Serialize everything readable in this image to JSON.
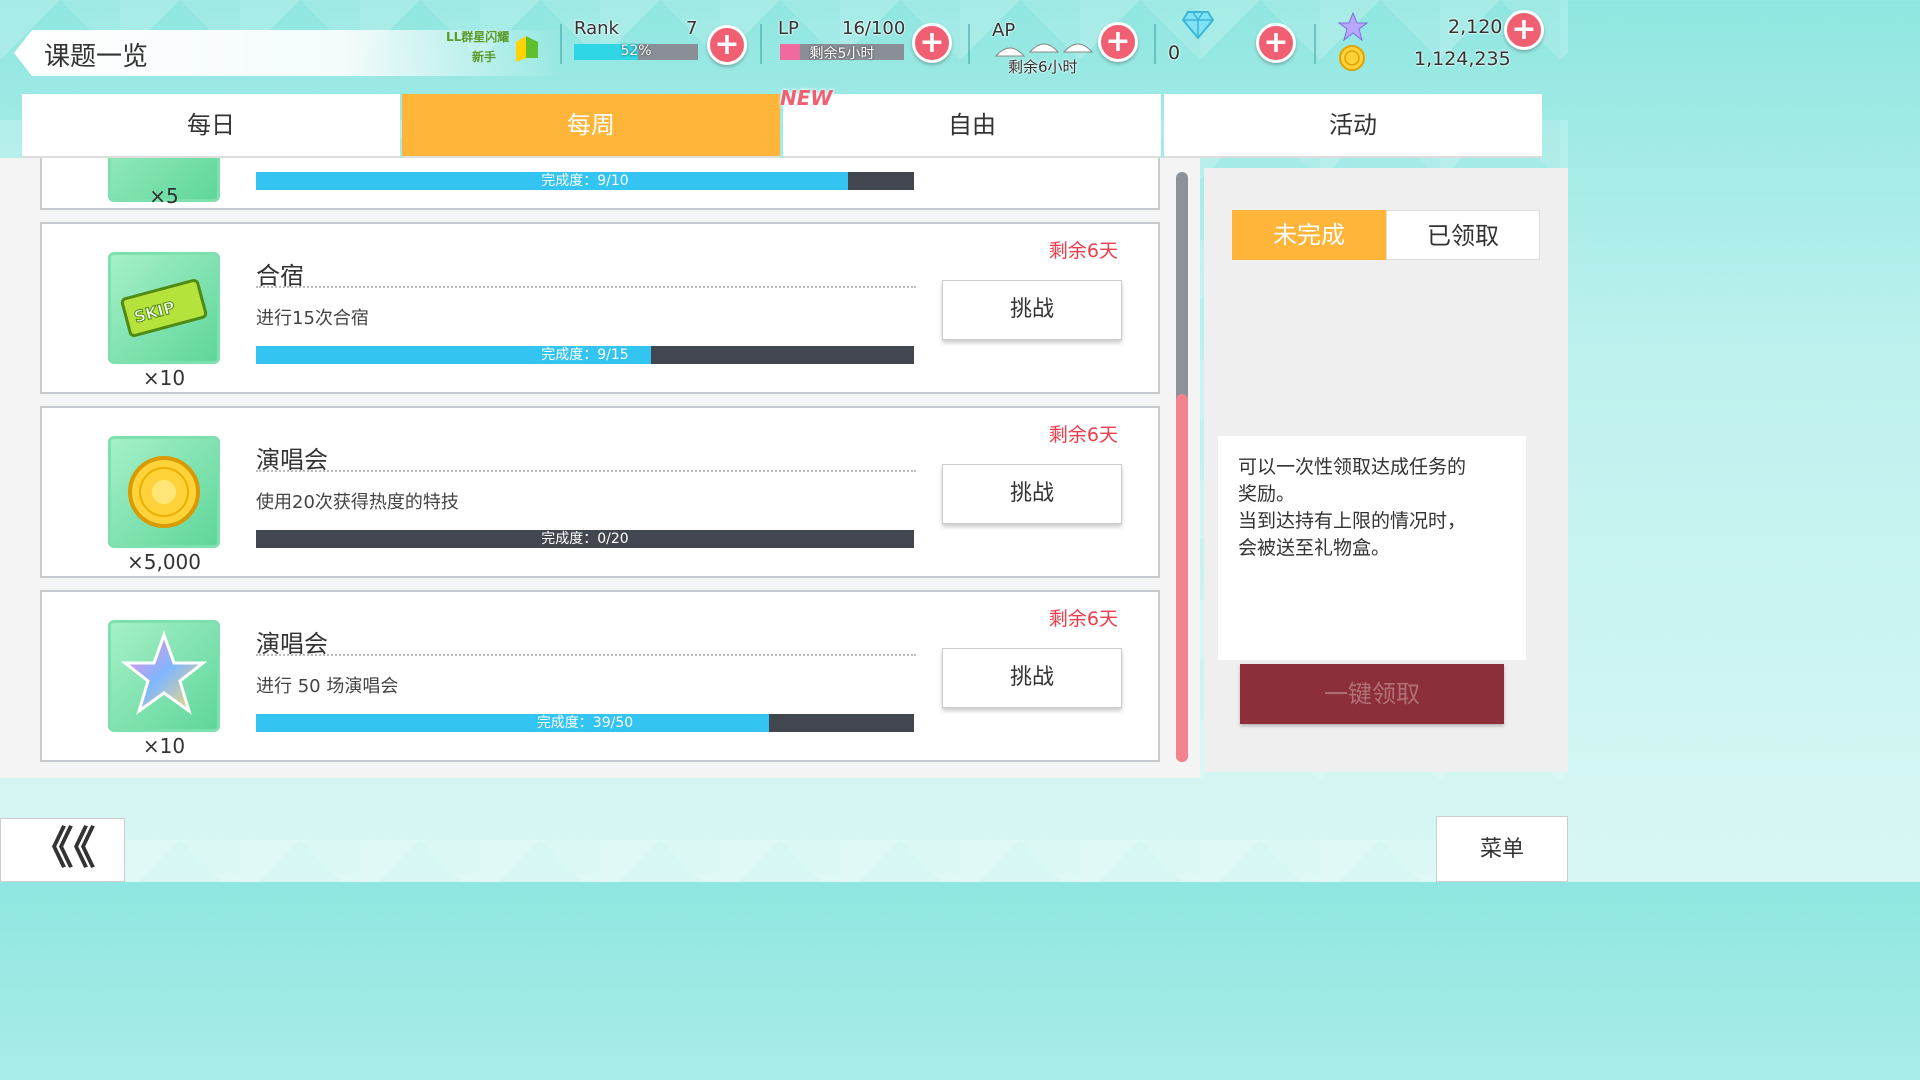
{
  "header": {
    "page_title": "课题一览",
    "badge_line1": "LL群星闪耀",
    "badge_line2": "新手",
    "rank": {
      "label": "Rank",
      "value": "7",
      "progress_text": "52%",
      "progress": 0.52
    },
    "lp": {
      "label": "LP",
      "value": "16/100",
      "bar_text": "剩余5小时",
      "progress": 0.16
    },
    "ap": {
      "label": "AP",
      "sub_text": "剩余6小时"
    },
    "gems": {
      "value": "0",
      "icon": "diamond-icon"
    },
    "star_currency": {
      "value": "2,120",
      "icon": "star-icon"
    },
    "coins": {
      "value": "1,124,235",
      "icon": "coin-icon"
    },
    "plus_label": "+"
  },
  "tabs": [
    {
      "label": "每日",
      "active": false
    },
    {
      "label": "每周",
      "active": true
    },
    {
      "label": "自由",
      "active": false
    },
    {
      "label": "活动",
      "active": false
    }
  ],
  "new_tag": "NEW",
  "quests": [
    {
      "reward_qty": "×5",
      "progress_text": "完成度：9/10",
      "progress": 0.9
    },
    {
      "title": "合宿",
      "desc": "进行15次合宿",
      "remaining": "剩余6天",
      "reward_icon": "skip-ticket-icon",
      "reward_text": "SKIP",
      "reward_qty": "×10",
      "progress_text": "完成度：9/15",
      "progress": 0.6,
      "button": "挑战"
    },
    {
      "title": "演唱会",
      "desc": "使用20次获得热度的特技",
      "remaining": "剩余6天",
      "reward_icon": "gold-coin-icon",
      "reward_qty": "×5,000",
      "progress_text": "完成度：0/20",
      "progress": 0.0,
      "button": "挑战"
    },
    {
      "title": "演唱会",
      "desc": "进行 50 场演唱会",
      "remaining": "剩余6天",
      "reward_icon": "rainbow-star-icon",
      "reward_qty": "×10",
      "progress_text": "完成度：39/50",
      "progress": 0.78,
      "button": "挑战"
    }
  ],
  "right_panel": {
    "filter_incomplete": "未完成",
    "filter_claimed": "已领取",
    "info_lines": [
      "可以一次性领取达成任务的",
      "奖励。",
      "当到达持有上限的情况时，",
      "会被送至礼物盒。"
    ],
    "claim_all": "一键领取"
  },
  "footer": {
    "back": "《《",
    "menu": "菜单"
  },
  "colors": {
    "accent_orange": "#ffb43a",
    "progress_blue": "#33c4f2",
    "remaining_red": "#ef3d4a",
    "plus_pink": "#f06072"
  }
}
